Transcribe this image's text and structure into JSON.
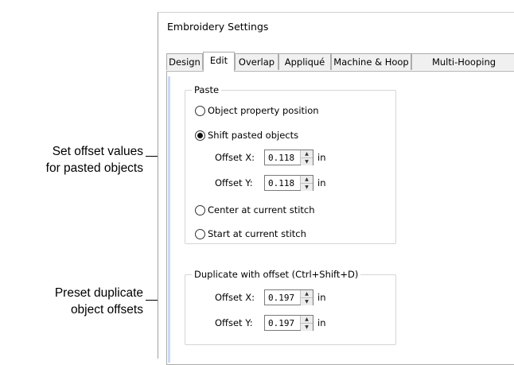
{
  "callouts": [
    {
      "line1": "Set offset values",
      "line2": "for pasted objects"
    },
    {
      "line1": "Preset duplicate",
      "line2": "object offsets"
    }
  ],
  "dialog": {
    "title": "Embroidery Settings",
    "tabs": [
      {
        "label": "Design",
        "active": false
      },
      {
        "label": "Edit",
        "active": true
      },
      {
        "label": "Overlap",
        "active": false
      },
      {
        "label": "Appliqué",
        "active": false
      },
      {
        "label": "Machine & Hoop",
        "active": false
      },
      {
        "label": "Multi-Hooping",
        "active": false
      }
    ],
    "paste": {
      "legend": "Paste",
      "options": [
        {
          "label": "Object property position",
          "checked": false
        },
        {
          "label": "Shift pasted objects",
          "checked": true
        },
        {
          "label": "Center at current stitch",
          "checked": false
        },
        {
          "label": "Start at current stitch",
          "checked": false
        }
      ],
      "offset_x": {
        "label": "Offset X:",
        "value": "0.118",
        "unit": "in"
      },
      "offset_y": {
        "label": "Offset Y:",
        "value": "0.118",
        "unit": "in"
      }
    },
    "duplicate": {
      "legend": "Duplicate with offset (Ctrl+Shift+D)",
      "offset_x": {
        "label": "Offset X:",
        "value": "0.197",
        "unit": "in"
      },
      "offset_y": {
        "label": "Offset Y:",
        "value": "0.197",
        "unit": "in"
      }
    },
    "spin_up_glyph": "▲",
    "spin_down_glyph": "▼"
  }
}
